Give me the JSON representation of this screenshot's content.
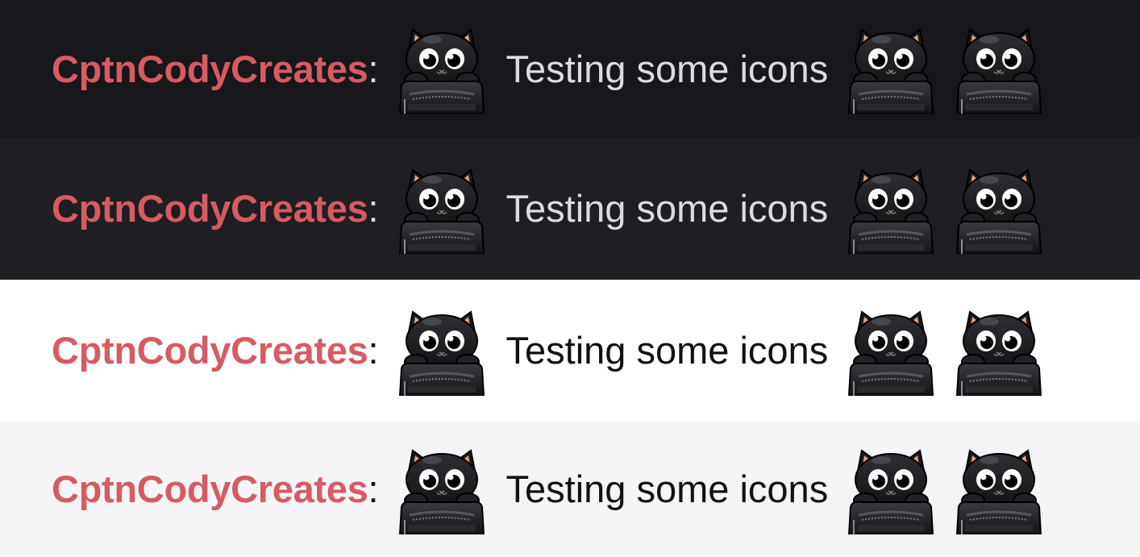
{
  "colors": {
    "username": "#d65b63",
    "text_on_dark": "#dcdcde",
    "text_on_light": "#111111"
  },
  "emote": {
    "name": "black-cat-backpack-emote"
  },
  "rows": [
    {
      "theme": "dark",
      "background": "#18171c",
      "username": "CptnCodyCreates",
      "colon": ":",
      "message": "Testing some icons"
    },
    {
      "theme": "dark-alt",
      "background": "#1f1e23",
      "username": "CptnCodyCreates",
      "colon": ":",
      "message": "Testing some icons"
    },
    {
      "theme": "light",
      "background": "#ffffff",
      "username": "CptnCodyCreates",
      "colon": ":",
      "message": "Testing some icons"
    },
    {
      "theme": "light-alt",
      "background": "#f5f5f7",
      "username": "CptnCodyCreates",
      "colon": ":",
      "message": "Testing some icons"
    }
  ]
}
